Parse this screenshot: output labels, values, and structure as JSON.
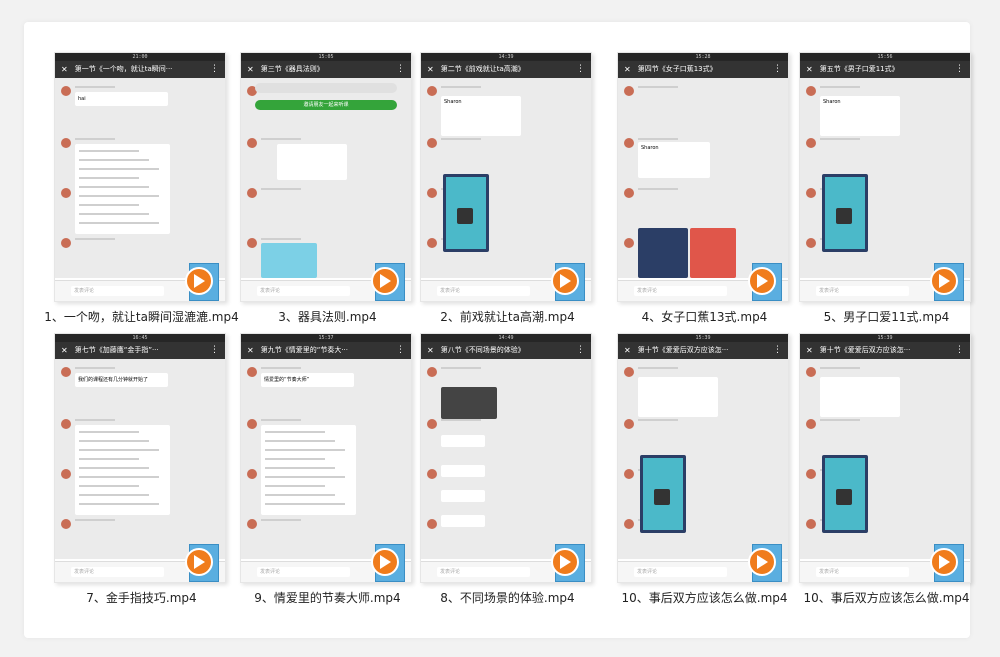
{
  "rows": [
    [
      {
        "caption": "1、一个吻，就让ta瞬间湿漉漉.mp4",
        "title": "第一节《一个吻，就让ta瞬间···",
        "time": "21:00",
        "bubble": "hai",
        "variant": "text"
      },
      {
        "caption": "3、器具法则.mp4",
        "title": "第三节《器具法则》",
        "time": "15:05",
        "bubble": "邀请朋友一起来听课",
        "variant": "invite"
      },
      {
        "caption": "2、前戏就让ta高潮.mp4",
        "title": "第二节《前戏就让ta高潮》",
        "time": "14:39",
        "bubble": "Sharon",
        "variant": "poster"
      },
      {
        "caption": "4、女子口蕉13式.mp4",
        "title": "第四节《女子口蕉13式》",
        "time": "15:28",
        "bubble": "Sharon",
        "variant": "card"
      },
      {
        "caption": "5、男子口爱11式.mp4",
        "title": "第五节《男子口爱11式》",
        "time": "15:56",
        "bubble": "Sharon",
        "variant": "poster"
      }
    ],
    [
      {
        "caption": "7、金手指技巧.mp4",
        "title": "第七节《加藤鹰“金手指”···",
        "time": "16:45",
        "bubble": "我们的课程还有几分钟就开始了",
        "variant": "text"
      },
      {
        "caption": "9、情爱里的节奏大师.mp4",
        "title": "第九节《情爱里的“节奏大···",
        "time": "15:37",
        "bubble": "情爱里的“节奏大师”",
        "variant": "text"
      },
      {
        "caption": "8、不同场景的体验.mp4",
        "title": "第八节《不同场景的体验》",
        "time": "14:49",
        "bubble": "",
        "variant": "image"
      },
      {
        "caption": "10、事后双方应该怎么做.mp4",
        "title": "第十节《爱爱后双方应该怎···",
        "time": "15:39",
        "bubble": "",
        "variant": "poster"
      },
      {
        "caption": "10、事后双方应该怎么做.mp4",
        "title": "第十节《爱爱后双方应该怎···",
        "time": "15:39",
        "bubble": "",
        "variant": "poster"
      }
    ]
  ],
  "input_placeholder": "发表评论",
  "colors": {
    "accent": "#34a43a",
    "play": "#f07c1c",
    "titlebar": "#333333"
  }
}
